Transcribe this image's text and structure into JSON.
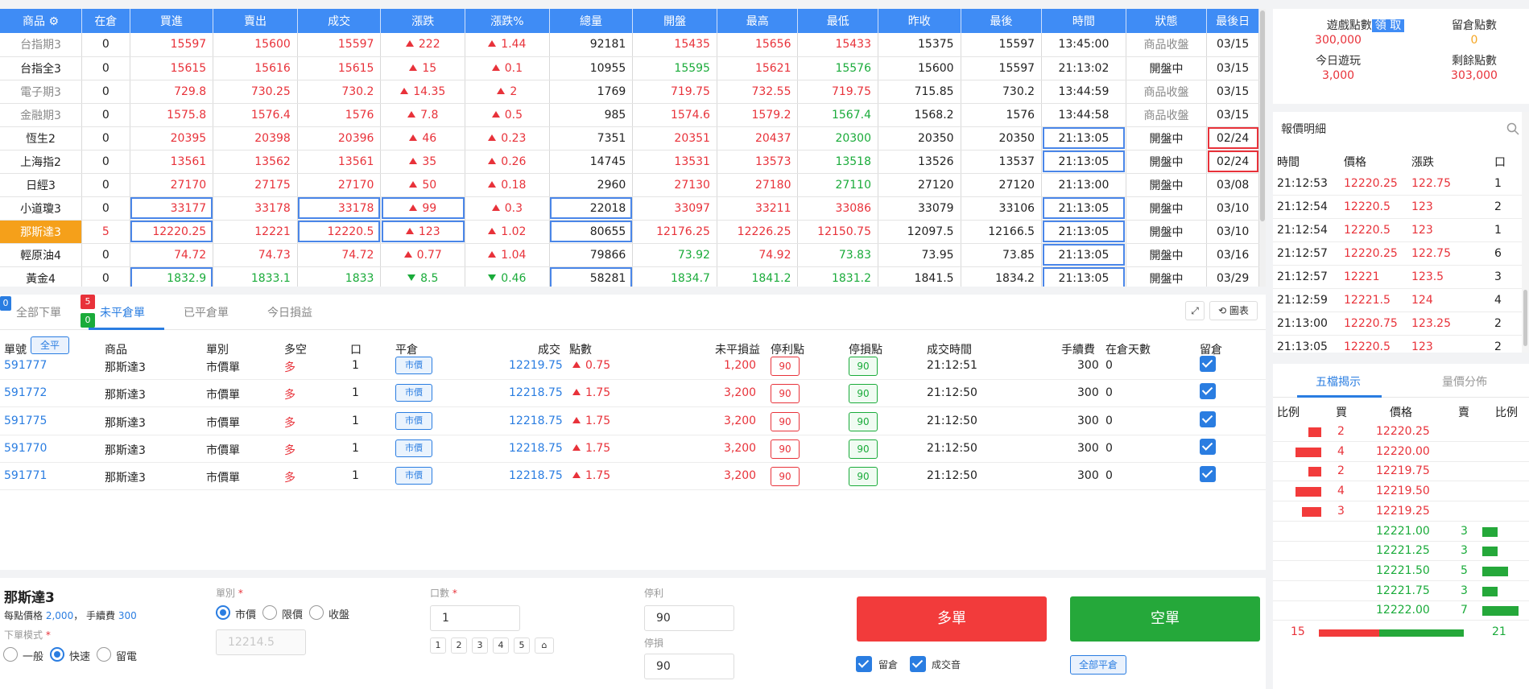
{
  "quotes": {
    "headers": [
      "商品",
      "在倉",
      "買進",
      "賣出",
      "成交",
      "漲跌",
      "漲跌%",
      "總量",
      "開盤",
      "最高",
      "最低",
      "昨收",
      "最後",
      "時間",
      "狀態",
      "最後日"
    ],
    "rows": [
      {
        "name": "台指期3",
        "pos": "0",
        "bid": "15597",
        "ask": "15600",
        "last": "15597",
        "chg": "222",
        "chgp": "1.44",
        "vol": "92181",
        "open": "15435",
        "high": "15656",
        "low": "15433",
        "prev": "15375",
        "final": "15597",
        "time": "13:45:00",
        "status": "商品收盤",
        "date": "03/15"
      },
      {
        "name": "台指全3",
        "pos": "0",
        "bid": "15615",
        "ask": "15616",
        "last": "15615",
        "chg": "15",
        "chgp": "0.1",
        "vol": "10955",
        "open": "15595",
        "high": "15621",
        "low": "15576",
        "prev": "15600",
        "final": "15597",
        "time": "21:13:02",
        "status": "開盤中",
        "date": "03/15"
      },
      {
        "name": "電子期3",
        "pos": "0",
        "bid": "729.8",
        "ask": "730.25",
        "last": "730.2",
        "chg": "14.35",
        "chgp": "2",
        "vol": "1769",
        "open": "719.75",
        "high": "732.55",
        "low": "719.75",
        "prev": "715.85",
        "final": "730.2",
        "time": "13:44:59",
        "status": "商品收盤",
        "date": "03/15"
      },
      {
        "name": "金融期3",
        "pos": "0",
        "bid": "1575.8",
        "ask": "1576.4",
        "last": "1576",
        "chg": "7.8",
        "chgp": "0.5",
        "vol": "985",
        "open": "1574.6",
        "high": "1579.2",
        "low": "1567.4",
        "prev": "1568.2",
        "final": "1576",
        "time": "13:44:58",
        "status": "商品收盤",
        "date": "03/15"
      },
      {
        "name": "恆生2",
        "pos": "0",
        "bid": "20395",
        "ask": "20398",
        "last": "20396",
        "chg": "46",
        "chgp": "0.23",
        "vol": "7351",
        "open": "20351",
        "high": "20437",
        "low": "20300",
        "prev": "20350",
        "final": "20350",
        "time": "21:13:05",
        "status": "開盤中",
        "date": "02/24"
      },
      {
        "name": "上海指2",
        "pos": "0",
        "bid": "13561",
        "ask": "13562",
        "last": "13561",
        "chg": "35",
        "chgp": "0.26",
        "vol": "14745",
        "open": "13531",
        "high": "13573",
        "low": "13518",
        "prev": "13526",
        "final": "13537",
        "time": "21:13:05",
        "status": "開盤中",
        "date": "02/24"
      },
      {
        "name": "日經3",
        "pos": "0",
        "bid": "27170",
        "ask": "27175",
        "last": "27170",
        "chg": "50",
        "chgp": "0.18",
        "vol": "2960",
        "open": "27130",
        "high": "27180",
        "low": "27110",
        "prev": "27120",
        "final": "27120",
        "time": "21:13:00",
        "status": "開盤中",
        "date": "03/08"
      },
      {
        "name": "小道瓊3",
        "pos": "0",
        "bid": "33177",
        "ask": "33178",
        "last": "33178",
        "chg": "99",
        "chgp": "0.3",
        "vol": "22018",
        "open": "33097",
        "high": "33211",
        "low": "33086",
        "prev": "33079",
        "final": "33106",
        "time": "21:13:05",
        "status": "開盤中",
        "date": "03/10"
      },
      {
        "name": "那斯達3",
        "pos": "5",
        "bid": "12220.25",
        "ask": "12221",
        "last": "12220.5",
        "chg": "123",
        "chgp": "1.02",
        "vol": "80655",
        "open": "12176.25",
        "high": "12226.25",
        "low": "12150.75",
        "prev": "12097.5",
        "final": "12166.5",
        "time": "21:13:05",
        "status": "開盤中",
        "date": "03/10"
      },
      {
        "name": "輕原油4",
        "pos": "0",
        "bid": "74.72",
        "ask": "74.73",
        "last": "74.72",
        "chg": "0.77",
        "chgp": "1.04",
        "vol": "79866",
        "open": "73.92",
        "high": "74.92",
        "low": "73.83",
        "prev": "73.95",
        "final": "73.85",
        "time": "21:13:05",
        "status": "開盤中",
        "date": "03/16"
      },
      {
        "name": "黃金4",
        "pos": "0",
        "bid": "1832.9",
        "ask": "1833.1",
        "last": "1833",
        "chg": "8.5",
        "chgp": "0.46",
        "vol": "58281",
        "open": "1834.7",
        "high": "1841.2",
        "low": "1831.2",
        "prev": "1841.5",
        "final": "1834.2",
        "time": "21:13:05",
        "status": "開盤中",
        "date": "03/29"
      }
    ]
  },
  "orders": {
    "tabs": [
      "全部下單",
      "未平倉單",
      "已平倉單",
      "今日損益"
    ],
    "badges": [
      "0",
      "5",
      "0"
    ],
    "expand_icon": "expand-icon",
    "chart_button": "圖表",
    "headers": {
      "id": "單號",
      "all_flat": "全平",
      "product": "商品",
      "type": "單別",
      "side": "多空",
      "qty": "口",
      "close": "平倉",
      "fill": "成交",
      "points": "點數",
      "pnl": "未平損益",
      "tp": "停利點",
      "sl": "停損點",
      "time": "成交時間",
      "fee": "手續費",
      "days": "在倉天數",
      "keep": "留倉"
    },
    "rows": [
      {
        "id": "591777",
        "product": "那斯達3",
        "type": "市價單",
        "side": "多",
        "qty": "1",
        "close": "市價",
        "fill": "12219.75",
        "points": "0.75",
        "pnl": "1,200",
        "tp": "90",
        "sl": "90",
        "time": "21:12:51",
        "fee": "300",
        "days": "0"
      },
      {
        "id": "591772",
        "product": "那斯達3",
        "type": "市價單",
        "side": "多",
        "qty": "1",
        "close": "市價",
        "fill": "12218.75",
        "points": "1.75",
        "pnl": "3,200",
        "tp": "90",
        "sl": "90",
        "time": "21:12:50",
        "fee": "300",
        "days": "0"
      },
      {
        "id": "591775",
        "product": "那斯達3",
        "type": "市價單",
        "side": "多",
        "qty": "1",
        "close": "市價",
        "fill": "12218.75",
        "points": "1.75",
        "pnl": "3,200",
        "tp": "90",
        "sl": "90",
        "time": "21:12:50",
        "fee": "300",
        "days": "0"
      },
      {
        "id": "591770",
        "product": "那斯達3",
        "type": "市價單",
        "side": "多",
        "qty": "1",
        "close": "市價",
        "fill": "12218.75",
        "points": "1.75",
        "pnl": "3,200",
        "tp": "90",
        "sl": "90",
        "time": "21:12:50",
        "fee": "300",
        "days": "0"
      },
      {
        "id": "591771",
        "product": "那斯達3",
        "type": "市價單",
        "side": "多",
        "qty": "1",
        "close": "市價",
        "fill": "12218.75",
        "points": "1.75",
        "pnl": "3,200",
        "tp": "90",
        "sl": "90",
        "time": "21:12:50",
        "fee": "300",
        "days": "0"
      }
    ]
  },
  "entry": {
    "product": "那斯達3",
    "point_value_label": "每點價格",
    "point_value": "2,000",
    "fee_label": "手續費",
    "fee": "300",
    "mode_label": "下單模式",
    "modes": [
      "一般",
      "快速",
      "留電"
    ],
    "type_label": "單別",
    "types": [
      "市價",
      "限價",
      "收盤"
    ],
    "price_placeholder": "12214.5",
    "qty_label": "口數",
    "qty_value": "1",
    "qty_presets": [
      "1",
      "2",
      "3",
      "4",
      "5"
    ],
    "tp_label": "停利",
    "tp_value": "90",
    "sl_label": "停損",
    "sl_value": "90",
    "long_button": "多單",
    "short_button": "空單",
    "keep_label": "留倉",
    "sound_label": "成交音",
    "close_all_button": "全部平倉",
    "required_mark": "*"
  },
  "points": {
    "game_label": "遊戲點數",
    "claim_button": "領 取",
    "game_value": "300,000",
    "keep_label": "留倉點數",
    "keep_value": "0",
    "today_label": "今日遊玩",
    "today_value": "3,000",
    "remain_label": "剩餘點數",
    "remain_value": "303,000"
  },
  "ticks": {
    "title": "報價明細",
    "headers": [
      "時間",
      "價格",
      "漲跌",
      "口"
    ],
    "rows": [
      {
        "time": "21:12:53",
        "price": "12220.25",
        "chg": "122.75",
        "qty": "1"
      },
      {
        "time": "21:12:54",
        "price": "12220.5",
        "chg": "123",
        "qty": "2"
      },
      {
        "time": "21:12:54",
        "price": "12220.5",
        "chg": "123",
        "qty": "1"
      },
      {
        "time": "21:12:57",
        "price": "12220.25",
        "chg": "122.75",
        "qty": "6"
      },
      {
        "time": "21:12:57",
        "price": "12221",
        "chg": "123.5",
        "qty": "3"
      },
      {
        "time": "21:12:59",
        "price": "12221.5",
        "chg": "124",
        "qty": "4"
      },
      {
        "time": "21:13:00",
        "price": "12220.75",
        "chg": "123.25",
        "qty": "2"
      },
      {
        "time": "21:13:05",
        "price": "12220.5",
        "chg": "123",
        "qty": "2"
      }
    ]
  },
  "depth": {
    "tabs": [
      "五檔揭示",
      "量價分佈"
    ],
    "headers": [
      "比例",
      "買",
      "價格",
      "賣",
      "比例"
    ],
    "bids": [
      {
        "qty": "2",
        "price": "12220.25",
        "ratio": 0.5
      },
      {
        "qty": "4",
        "price": "12220.00",
        "ratio": 1.0
      },
      {
        "qty": "2",
        "price": "12219.75",
        "ratio": 0.5
      },
      {
        "qty": "4",
        "price": "12219.50",
        "ratio": 1.0
      },
      {
        "qty": "3",
        "price": "12219.25",
        "ratio": 0.75
      }
    ],
    "asks": [
      {
        "qty": "3",
        "price": "12221.00",
        "ratio": 0.6
      },
      {
        "qty": "3",
        "price": "12221.25",
        "ratio": 0.6
      },
      {
        "qty": "5",
        "price": "12221.50",
        "ratio": 1.0
      },
      {
        "qty": "3",
        "price": "12221.75",
        "ratio": 0.6
      },
      {
        "qty": "7",
        "price": "12222.00",
        "ratio": 1.4
      }
    ],
    "total_bid": "15",
    "total_ask": "21",
    "bid_share": 0.4167
  },
  "colors": {
    "up": "#e8323a",
    "down": "#1aab3a",
    "accent": "#2a7de1",
    "header": "#3f8cf5",
    "highlight": "#f5a01a"
  }
}
